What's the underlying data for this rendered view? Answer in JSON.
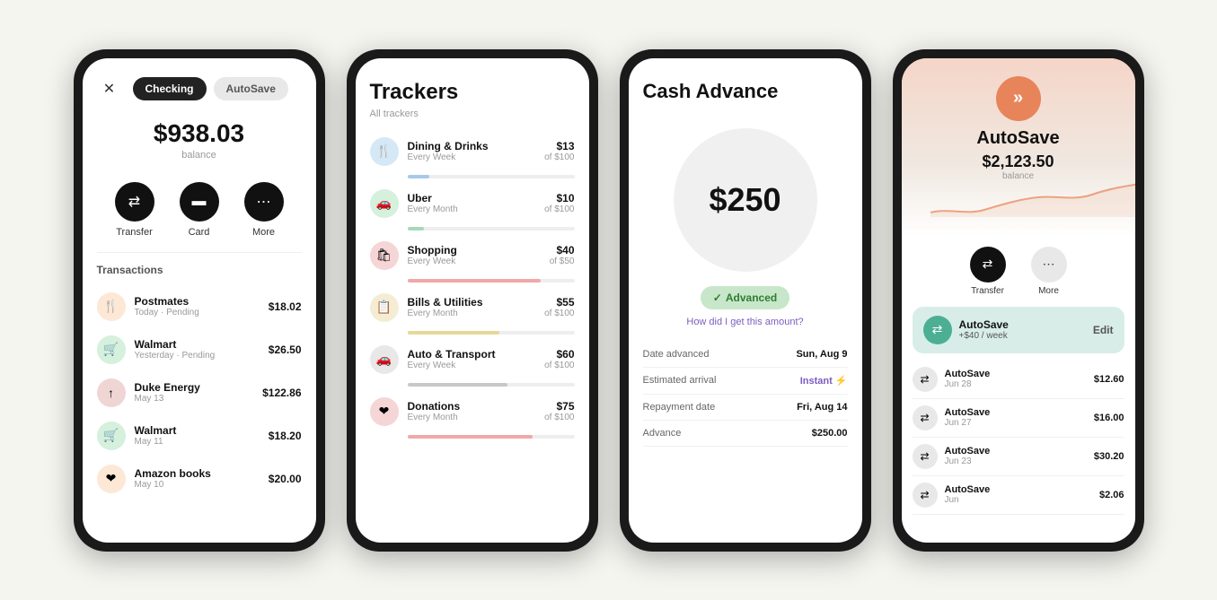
{
  "phone1": {
    "tabs": [
      {
        "label": "Checking",
        "active": true
      },
      {
        "label": "AutoSave",
        "active": false
      }
    ],
    "balance": "$938.03",
    "balance_label": "balance",
    "actions": [
      {
        "label": "Transfer",
        "icon": "⇄"
      },
      {
        "label": "Card",
        "icon": "💳"
      },
      {
        "label": "More",
        "icon": "•••"
      }
    ],
    "section_title": "Transactions",
    "transactions": [
      {
        "name": "Postmates",
        "date": "Today · Pending",
        "amount": "$18.02",
        "icon": "🍴",
        "bg": "#fce8d5"
      },
      {
        "name": "Walmart",
        "date": "Yesterday · Pending",
        "amount": "$26.50",
        "icon": "🛒",
        "bg": "#d5f0dc"
      },
      {
        "name": "Duke Energy",
        "date": "May 13",
        "amount": "$122.86",
        "icon": "⬆",
        "bg": "#f0d5d5"
      },
      {
        "name": "Walmart",
        "date": "May 11",
        "amount": "$18.20",
        "icon": "🛒",
        "bg": "#d5f0dc"
      },
      {
        "name": "Amazon books",
        "date": "May 10",
        "amount": "$20.00",
        "icon": "❤",
        "bg": "#fce8d5"
      }
    ]
  },
  "phone2": {
    "title": "Trackers",
    "subtitle": "All trackers",
    "trackers": [
      {
        "name": "Dining & Drinks",
        "freq": "Every Week",
        "spent": "$13",
        "total": "of $100",
        "bar_pct": 13,
        "bar_color": "#a8c8e8",
        "icon": "🍴",
        "bg": "#d5e8f5"
      },
      {
        "name": "Uber",
        "freq": "Every Month",
        "spent": "$10",
        "total": "of $100",
        "bar_pct": 10,
        "bar_color": "#a8d8b8",
        "icon": "🚗",
        "bg": "#d5f0dc"
      },
      {
        "name": "Shopping",
        "freq": "Every Week",
        "spent": "$40",
        "total": "of $50",
        "bar_pct": 80,
        "bar_color": "#f0a8a8",
        "icon": "🛍",
        "bg": "#f5d5d5"
      },
      {
        "name": "Bills & Utilities",
        "freq": "Every Month",
        "spent": "$55",
        "total": "of $100",
        "bar_pct": 55,
        "bar_color": "#e8d898",
        "icon": "📋",
        "bg": "#f5ecd5"
      },
      {
        "name": "Auto & Transport",
        "freq": "Every Week",
        "spent": "$60",
        "total": "of $100",
        "bar_pct": 60,
        "bar_color": "#c8c8c8",
        "icon": "🚗",
        "bg": "#e8e8e8"
      },
      {
        "name": "Donations",
        "freq": "Every Month",
        "spent": "$75",
        "total": "of $100",
        "bar_pct": 75,
        "bar_color": "#f0a8a8",
        "icon": "❤",
        "bg": "#f5d5d5"
      }
    ]
  },
  "phone3": {
    "title": "Cash Advance",
    "amount": "$250",
    "badge": "Advanced",
    "badge_check": "✓",
    "link": "How did I get this amount?",
    "details": [
      {
        "label": "Date advanced",
        "value": "Sun, Aug 9",
        "special": false
      },
      {
        "label": "Estimated arrival",
        "value": "Instant ⚡",
        "special": true
      },
      {
        "label": "Repayment date",
        "value": "Fri, Aug 14",
        "special": false
      },
      {
        "label": "Advance",
        "value": "$250.00",
        "special": false
      }
    ]
  },
  "phone4": {
    "logo_text": "»",
    "name": "AutoSave",
    "balance": "$2,123.50",
    "balance_label": "balance",
    "actions": [
      {
        "label": "Transfer",
        "icon": "⇄",
        "dark": true
      },
      {
        "label": "More",
        "icon": "•••",
        "dark": false
      }
    ],
    "autosave_card": {
      "name": "AutoSave",
      "freq": "+$40 / week",
      "edit_label": "Edit"
    },
    "transactions": [
      {
        "name": "AutoSave",
        "date": "Jun 28",
        "amount": "$12.60"
      },
      {
        "name": "AutoSave",
        "date": "Jun 27",
        "amount": "$16.00"
      },
      {
        "name": "AutoSave",
        "date": "Jun 23",
        "amount": "$30.20"
      },
      {
        "name": "AutoSave",
        "date": "Jun",
        "amount": "$2.06"
      }
    ]
  }
}
